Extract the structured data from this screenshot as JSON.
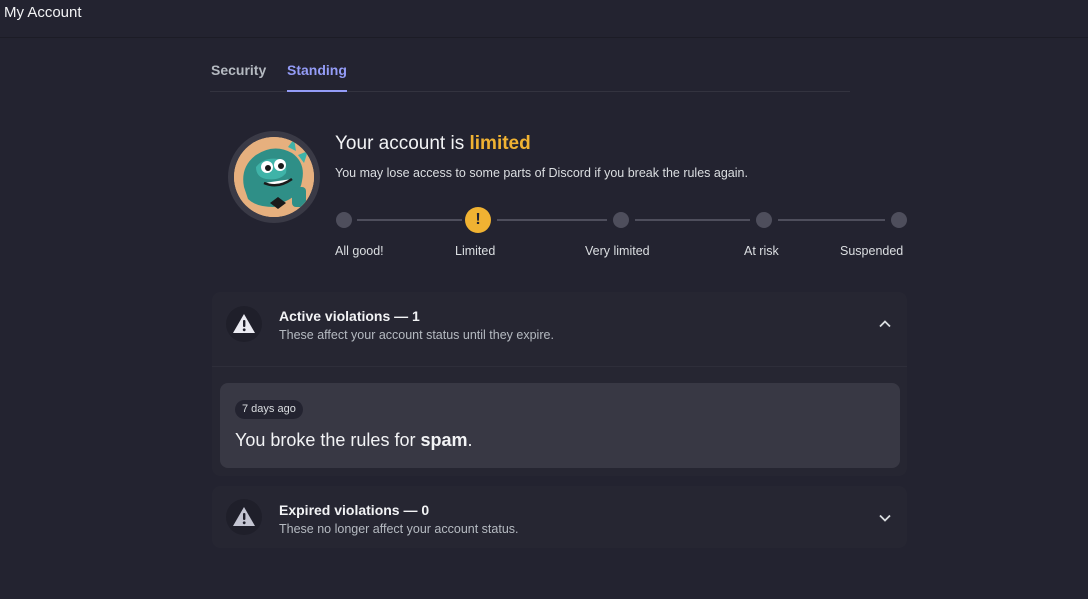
{
  "window": {
    "title": "My Account"
  },
  "tabs": [
    {
      "label": "Security"
    },
    {
      "label": "Standing"
    }
  ],
  "status": {
    "heading_prefix": "Your account is ",
    "level": "limited",
    "description": "You may lose access to some parts of Discord if you break the rules again.",
    "steps": [
      "All good!",
      "Limited",
      "Very limited",
      "At risk",
      "Suspended"
    ],
    "current_step_marker": "!"
  },
  "active_violations": {
    "title": "Active violations — 1",
    "description": "These affect your account status until they expire.",
    "items": [
      {
        "time": "7 days ago",
        "text_prefix": "You broke the rules for ",
        "reason": "spam",
        "text_suffix": "."
      }
    ]
  },
  "expired_violations": {
    "title": "Expired violations — 0",
    "description": "These no longer affect your account status."
  },
  "colors": {
    "accent": "#949cf7",
    "limited": "#f0b232",
    "background": "#232330"
  }
}
